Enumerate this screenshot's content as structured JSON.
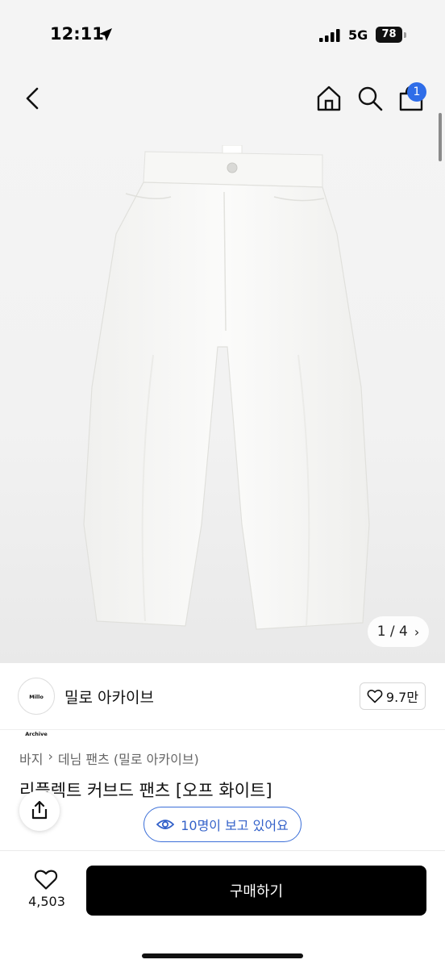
{
  "status_bar": {
    "time": "12:11",
    "network": "5G",
    "battery": "78"
  },
  "header": {
    "cart_badge_count": "1"
  },
  "gallery": {
    "current": "1",
    "separator": "/",
    "total": "4",
    "counter_text": "1 / 4",
    "next_icon": "chevron-right-icon"
  },
  "brand": {
    "logo_text": "Millo Archive",
    "name": "밀로 아카이브",
    "likes": "9.7만"
  },
  "product": {
    "breadcrumb": [
      "바지",
      "데님 팬츠 (밀로 아카이브)"
    ],
    "title": "리플렉트 커브드 팬츠 [오프 화이트]",
    "viewers_text": "10명이 보고 있어요"
  },
  "bottom": {
    "wish_count": "4,503",
    "buy_label": "구매하기"
  },
  "colors": {
    "accent_blue": "#3361c9",
    "badge_blue": "#2f6de8",
    "buy_button_bg": "#000000"
  }
}
